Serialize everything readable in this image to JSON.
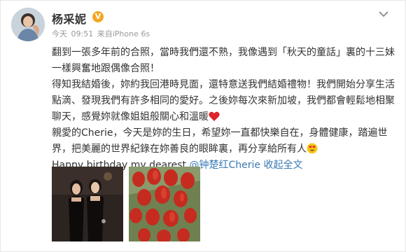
{
  "user": {
    "name": "杨采妮",
    "verified_badge": "V",
    "verified_color": "#f5a623"
  },
  "meta": {
    "date": "今天",
    "time": "09:51",
    "source": "来自iPhone 6s"
  },
  "post": {
    "lines": [
      "翻到一張多年前的合照，當時我們還不熟，我像遇到「秋天的童話」裏的十三妹",
      "一樣興奮地跟偶像合照！",
      "得知我結婚後，妳約我回港時見面，還特意送我們結婚禮物！我們開始分享生活",
      "點滴、發現我們有許多相同的愛好。之後妳每次來新加坡，我們都會輕鬆地相聚",
      "聊天，感覺妳就像姐姐般關心和溫暖",
      "親愛的Cherie，今天是妳的生日，希望妳一直都快樂自在，身體健康，踏遍世",
      "界，把美麗的世界紀錄在妳善良的眼眸裏，再分享給所有人"
    ],
    "english_line": "Happy birthday my dearest ",
    "mention": "@钟楚红Cherie",
    "expand_label": " 收起全文"
  },
  "colors": {
    "link": "#3a79b5",
    "text": "#333333",
    "meta": "#999999"
  },
  "icons": {
    "chevron": "chevron-down-icon",
    "heart": "red-heart-emoji",
    "face": "heart-eyes-emoji"
  }
}
